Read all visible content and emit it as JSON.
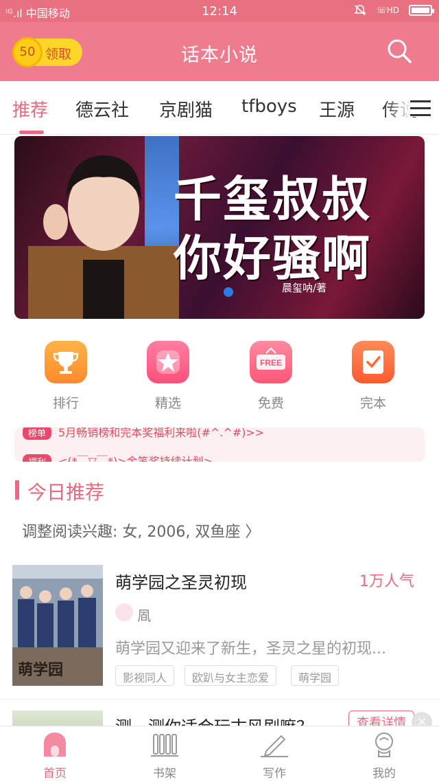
{
  "status_bar": {
    "carrier": "ᴵᴳ.ıl 中国移动",
    "time": "12:14",
    "hd": "HD"
  },
  "header": {
    "reward_amount": "50",
    "reward_label": "领取",
    "title": "话本小说"
  },
  "tabs": [
    "推荐",
    "德云社",
    "京剧猫",
    "tfboys",
    "王源",
    "传说"
  ],
  "banner": {
    "title_line1": "千玺叔叔",
    "title_line2": "你好骚啊",
    "author": "晨玺呐/著"
  },
  "shortcuts": [
    {
      "label": "排行",
      "icon": "trophy-icon",
      "color": "#ff9a3a"
    },
    {
      "label": "精选",
      "icon": "star-icon",
      "color": "#ff5f86"
    },
    {
      "label": "免费",
      "icon": "free-sign-icon",
      "color": "#ff6a86"
    },
    {
      "label": "完本",
      "icon": "check-note-icon",
      "color": "#ff7043"
    }
  ],
  "notices": [
    {
      "tag": "榜单",
      "text": "5月畅销榜和完本奖福利来啦(#^.^#)>>"
    },
    {
      "tag": "福利",
      "text": "<(*￣▽￣*)>金笔奖持续计划>"
    }
  ],
  "section": {
    "title": "今日推荐",
    "prefs": "调整阅读兴趣: 女, 2006, 双鱼座 〉"
  },
  "books": [
    {
      "title": "萌学园之圣灵初现",
      "popularity": "1万人气",
      "author": "凮",
      "description": "萌学园又迎来了新生，圣灵之星的初现...",
      "tags": [
        "影视同人",
        "欧趴与女主恋爱",
        "萌学园"
      ]
    },
    {
      "title": "测一测你适合玩古风剧嘛？",
      "action": "查看详情",
      "close": "×"
    }
  ],
  "bottom_nav": [
    {
      "label": "首页",
      "icon": "home-icon",
      "active": true
    },
    {
      "label": "书架",
      "icon": "bookshelf-icon",
      "active": false
    },
    {
      "label": "写作",
      "icon": "pencil-icon",
      "active": false
    },
    {
      "label": "我的",
      "icon": "profile-icon",
      "active": false
    }
  ],
  "colors": {
    "brand_pink": "#ef7b8e",
    "accent_pink": "#e96a7f",
    "reward_yellow": "#ffd62a"
  }
}
